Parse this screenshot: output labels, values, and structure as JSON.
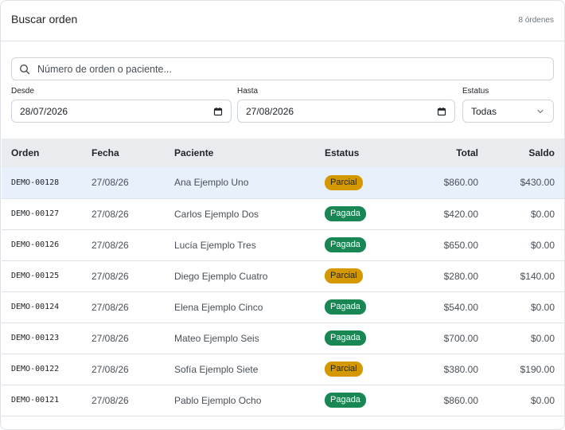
{
  "header": {
    "title": "Buscar orden",
    "count": "8 órdenes"
  },
  "search": {
    "placeholder": "Número de orden o paciente...",
    "value": ""
  },
  "filters": {
    "desde": {
      "label": "Desde",
      "value": "28/07/2026"
    },
    "hasta": {
      "label": "Hasta",
      "value": "27/08/2026"
    },
    "estatus": {
      "label": "Estatus",
      "value": "Todas"
    }
  },
  "table": {
    "columns": [
      "Orden",
      "Fecha",
      "Paciente",
      "Estatus",
      "Total",
      "Saldo"
    ],
    "rows": [
      {
        "orden": "DEMO-00128",
        "fecha": "27/08/26",
        "paciente": "Ana Ejemplo Uno",
        "estatus": "Parcial",
        "total": "$860.00",
        "saldo": "$430.00"
      },
      {
        "orden": "DEMO-00127",
        "fecha": "27/08/26",
        "paciente": "Carlos Ejemplo Dos",
        "estatus": "Pagada",
        "total": "$420.00",
        "saldo": "$0.00"
      },
      {
        "orden": "DEMO-00126",
        "fecha": "27/08/26",
        "paciente": "Lucía Ejemplo Tres",
        "estatus": "Pagada",
        "total": "$650.00",
        "saldo": "$0.00"
      },
      {
        "orden": "DEMO-00125",
        "fecha": "27/08/26",
        "paciente": "Diego Ejemplo Cuatro",
        "estatus": "Parcial",
        "total": "$280.00",
        "saldo": "$140.00"
      },
      {
        "orden": "DEMO-00124",
        "fecha": "27/08/26",
        "paciente": "Elena Ejemplo Cinco",
        "estatus": "Pagada",
        "total": "$540.00",
        "saldo": "$0.00"
      },
      {
        "orden": "DEMO-00123",
        "fecha": "27/08/26",
        "paciente": "Mateo Ejemplo Seis",
        "estatus": "Pagada",
        "total": "$700.00",
        "saldo": "$0.00"
      },
      {
        "orden": "DEMO-00122",
        "fecha": "27/08/26",
        "paciente": "Sofía Ejemplo Siete",
        "estatus": "Parcial",
        "total": "$380.00",
        "saldo": "$190.00"
      },
      {
        "orden": "DEMO-00121",
        "fecha": "27/08/26",
        "paciente": "Pablo Ejemplo Ocho",
        "estatus": "Pagada",
        "total": "$860.00",
        "saldo": "$0.00"
      }
    ]
  },
  "colors": {
    "paid": "#198754",
    "partial": "#d49800",
    "selected_row": "#e8f0fc",
    "header_bg": "#e9ecef"
  },
  "icons": {
    "search": "search-icon",
    "date": "calendar-icon",
    "select": "chevron-down-icon"
  }
}
